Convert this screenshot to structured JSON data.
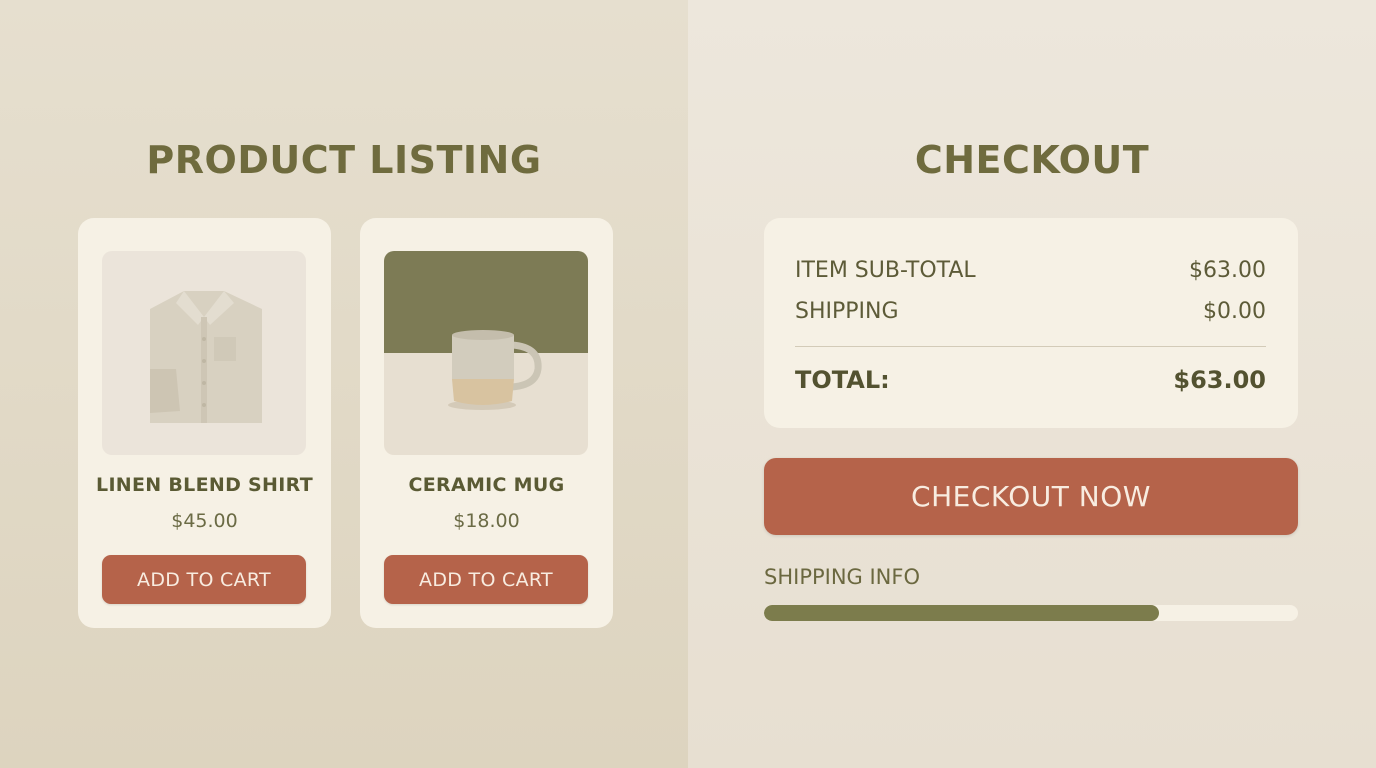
{
  "product_listing": {
    "title": "PRODUCT LISTING",
    "products": [
      {
        "name": "LINEN BLEND SHIRT",
        "price": "$45.00",
        "button_label": "ADD TO CART",
        "image": "linen-shirt-photo"
      },
      {
        "name": "CERAMIC MUG",
        "price": "$18.00",
        "button_label": "ADD TO CART",
        "image": "ceramic-mug-photo"
      }
    ]
  },
  "checkout": {
    "title": "CHECKOUT",
    "subtotal_label": "ITEM SUB-TOTAL",
    "subtotal_value": "$63.00",
    "shipping_label": "SHIPPING",
    "shipping_value": "$0.00",
    "total_label": "TOTAL:",
    "total_value": "$63.00",
    "button_label": "CHECKOUT NOW",
    "shipping_info_label": "SHIPPING INFO",
    "shipping_info_progress": 0.74
  },
  "colors": {
    "accent_terracotta": "#b5634a",
    "olive": "#6f6b3e",
    "progress_fill": "#7c7c4c",
    "card_background": "#f6f1e5"
  }
}
